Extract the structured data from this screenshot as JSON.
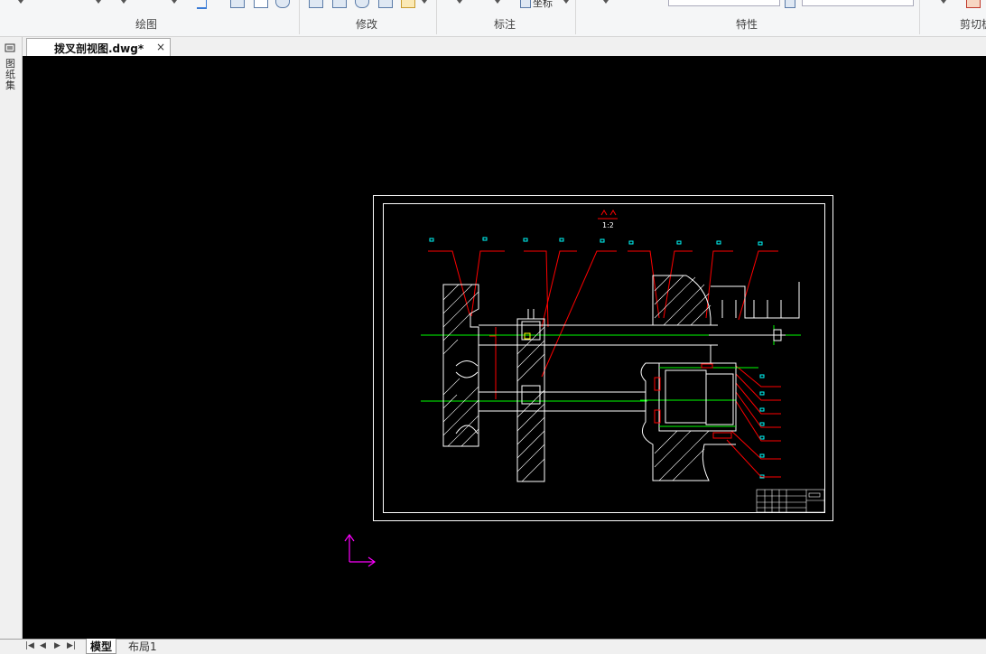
{
  "ribbon": {
    "panels": [
      {
        "label": "绘图"
      },
      {
        "label": "修改"
      },
      {
        "label": "标注"
      },
      {
        "label": "特性"
      },
      {
        "label": "剪切板"
      }
    ],
    "coordinate_label": "坐标"
  },
  "left_strip": {
    "label": "图纸集"
  },
  "document": {
    "tab_title": "拨叉剖视图.dwg*",
    "close_glyph": "×"
  },
  "drawing": {
    "scale_label": "1:2",
    "colors": {
      "background": "#000000",
      "outline": "#ffffff",
      "leader": "#ff0000",
      "centerline": "#00ff00",
      "balloon": "#00ffff",
      "ucs": "#ff00ff",
      "accent": "#ffff00"
    }
  },
  "layout_tabs": {
    "nav": [
      "|◀",
      "◀",
      "▶",
      "▶|"
    ],
    "tabs": [
      {
        "label": "模型",
        "active": true
      },
      {
        "label": "布局1",
        "active": false
      }
    ]
  }
}
